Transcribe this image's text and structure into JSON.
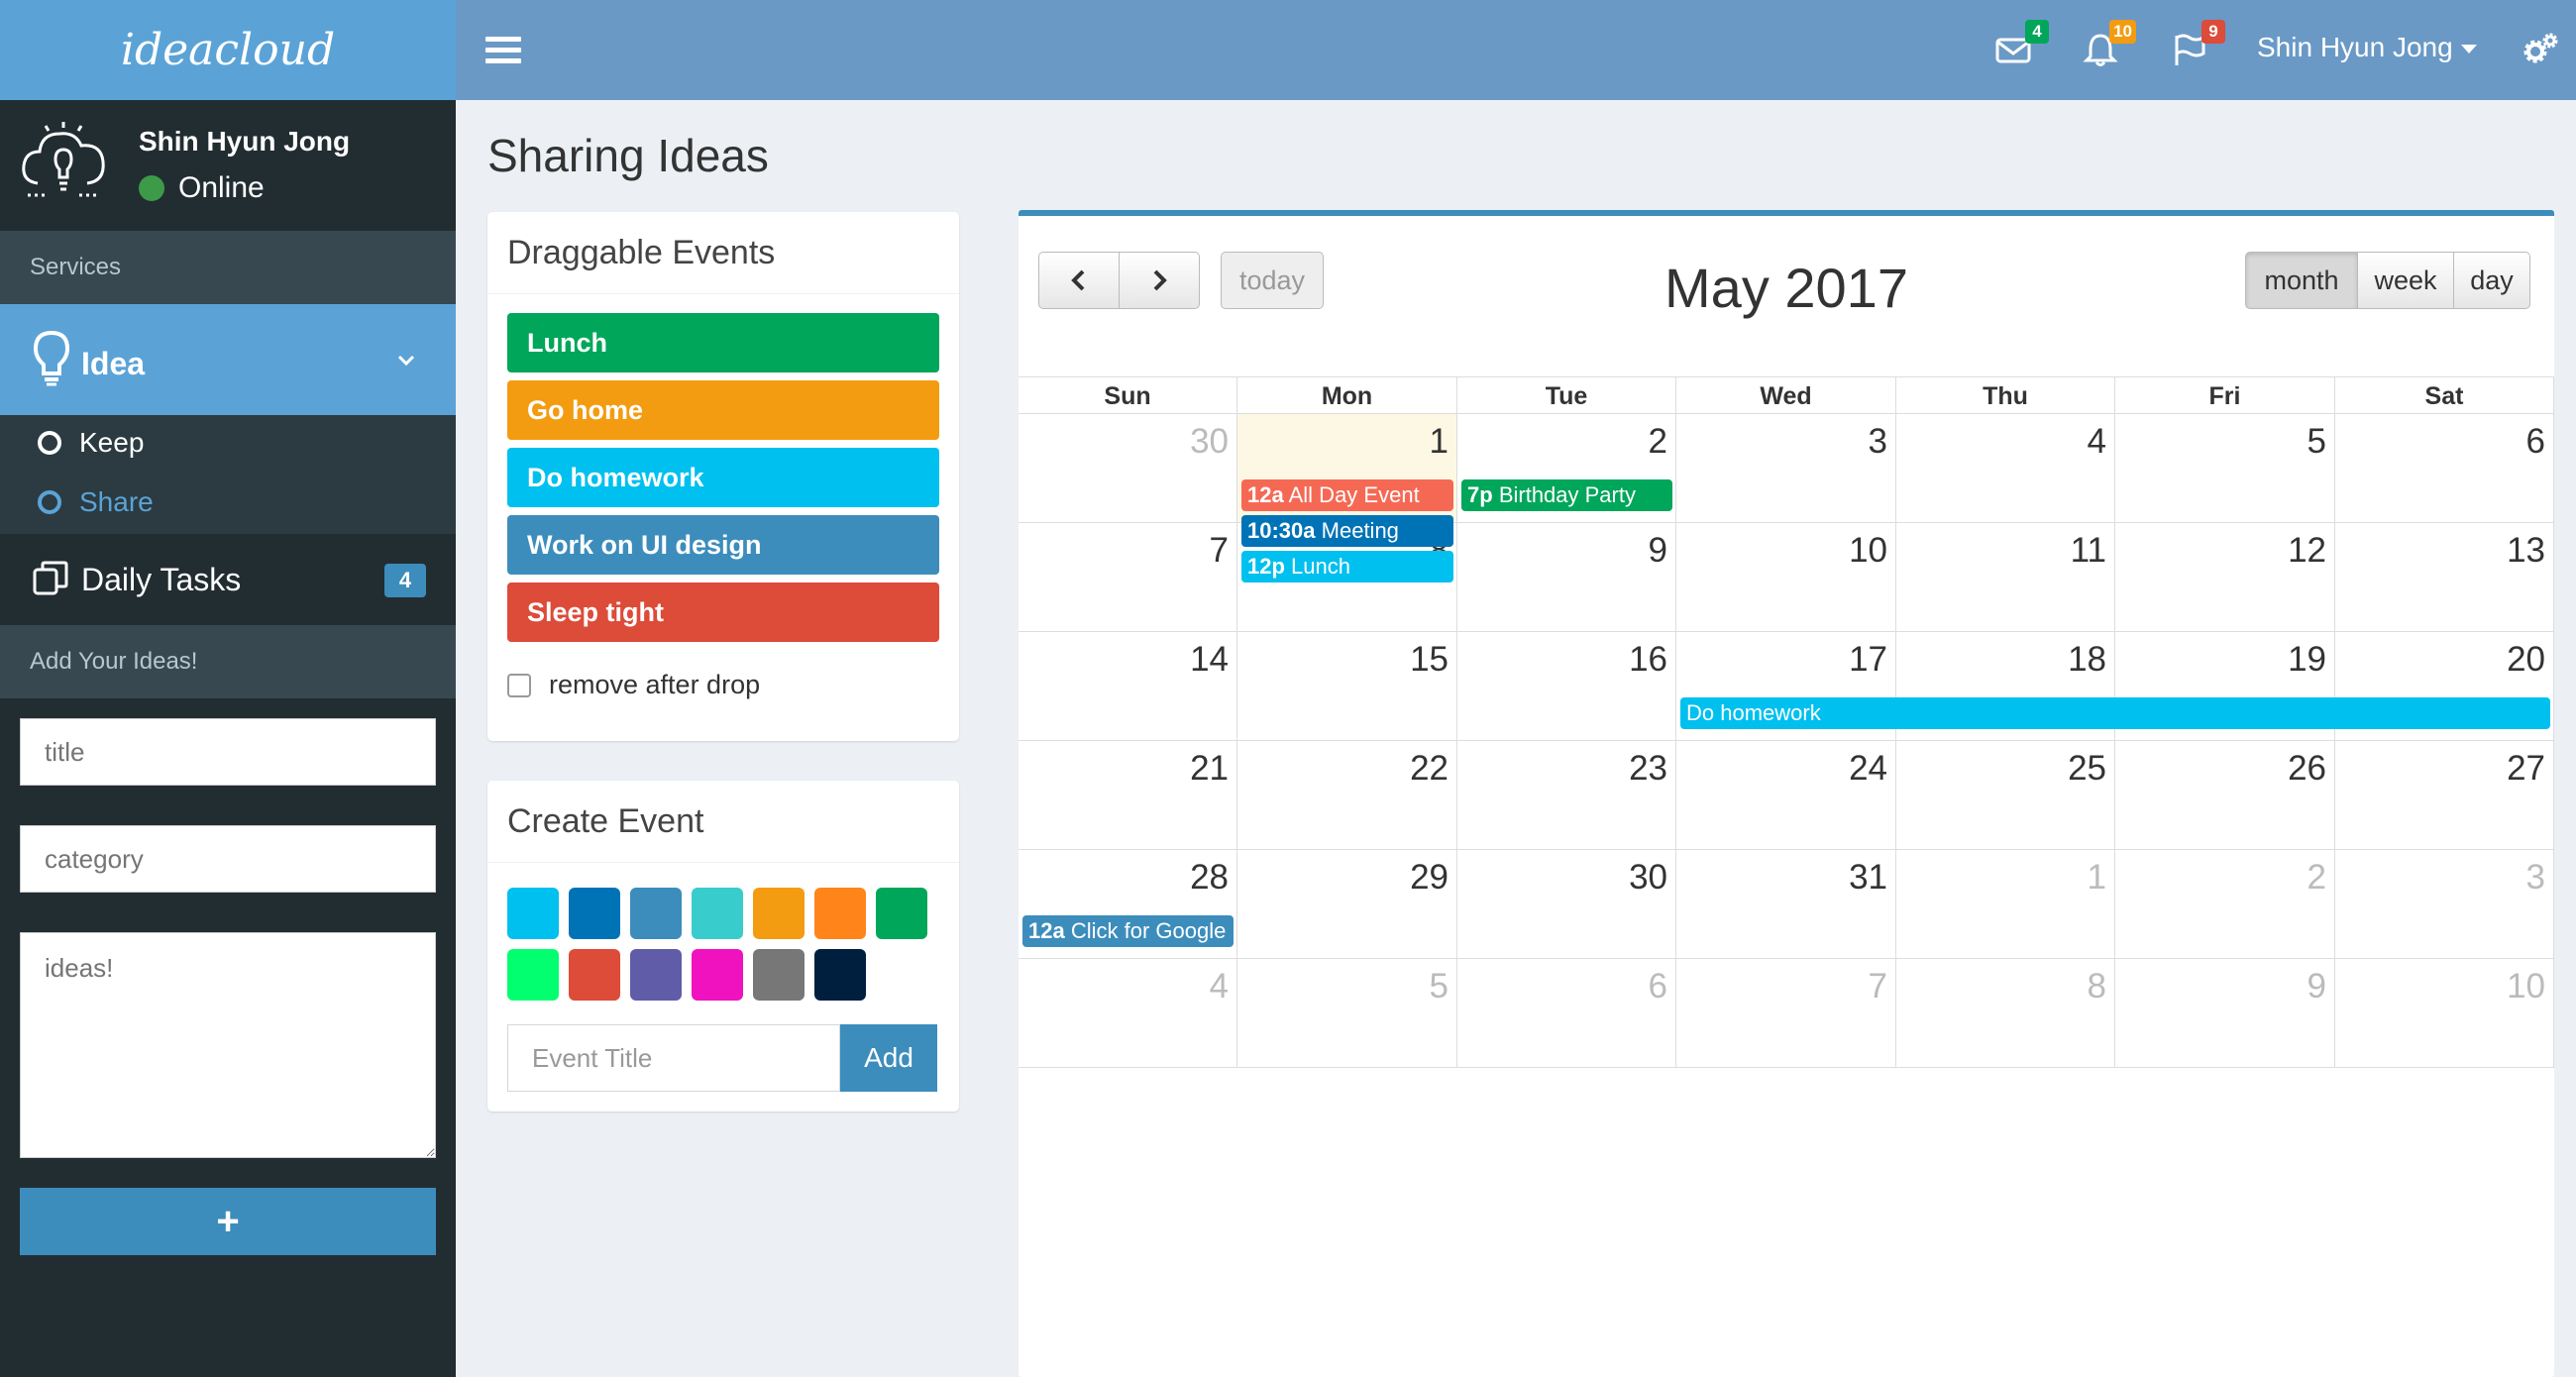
{
  "brand": {
    "logo": "ideacloud"
  },
  "navbar": {
    "mail_count": "4",
    "bell_count": "10",
    "flag_count": "9",
    "user_name": "Shin Hyun Jong",
    "colors": {
      "mail": "#00a65a",
      "bell": "#f39c12",
      "flag": "#dd4b39"
    }
  },
  "sidebar": {
    "user": {
      "name": "Shin Hyun Jong",
      "status": "Online"
    },
    "services_header": "Services",
    "idea": {
      "label": "Idea",
      "items": [
        {
          "label": "Keep"
        },
        {
          "label": "Share"
        }
      ]
    },
    "daily_tasks": {
      "label": "Daily Tasks",
      "count": "4"
    },
    "add_header": "Add Your Ideas!",
    "form": {
      "title_placeholder": "title",
      "category_placeholder": "category",
      "ideas_placeholder": "ideas!",
      "add_label": "+"
    }
  },
  "page": {
    "title": "Sharing Ideas"
  },
  "draggable": {
    "title": "Draggable Events",
    "events": [
      {
        "label": "Lunch",
        "color": "#00a65a"
      },
      {
        "label": "Go home",
        "color": "#f39c12"
      },
      {
        "label": "Do homework",
        "color": "#00c0ef"
      },
      {
        "label": "Work on UI design",
        "color": "#3c8dbc"
      },
      {
        "label": "Sleep tight",
        "color": "#dd4b39"
      }
    ],
    "remove_label": "remove after drop"
  },
  "create_event": {
    "title": "Create Event",
    "colors": [
      "#00c0ef",
      "#0073b7",
      "#3c8dbc",
      "#39cccc",
      "#f39c12",
      "#ff851b",
      "#00a65a",
      "#01ff70",
      "#dd4b39",
      "#605ca8",
      "#f012be",
      "#777777",
      "#001f3f"
    ],
    "input_placeholder": "Event Title",
    "add_label": "Add"
  },
  "calendar": {
    "title": "May 2017",
    "today_label": "today",
    "views": [
      "month",
      "week",
      "day"
    ],
    "active_view": "month",
    "weekdays": [
      "Sun",
      "Mon",
      "Tue",
      "Wed",
      "Thu",
      "Fri",
      "Sat"
    ],
    "weeks": [
      [
        "30",
        "1",
        "2",
        "3",
        "4",
        "5",
        "6"
      ],
      [
        "7",
        "8",
        "9",
        "10",
        "11",
        "12",
        "13"
      ],
      [
        "14",
        "15",
        "16",
        "17",
        "18",
        "19",
        "20"
      ],
      [
        "21",
        "22",
        "23",
        "24",
        "25",
        "26",
        "27"
      ],
      [
        "28",
        "29",
        "30",
        "31",
        "1",
        "2",
        "3"
      ],
      [
        "4",
        "5",
        "6",
        "7",
        "8",
        "9",
        "10"
      ]
    ],
    "events": [
      {
        "time": "12a",
        "title": "All Day Event",
        "color": "#f56954"
      },
      {
        "time": "10:30a",
        "title": "Meeting",
        "color": "#0073b7"
      },
      {
        "time": "12p",
        "title": "Lunch",
        "color": "#00c0ef"
      },
      {
        "time": "7p",
        "title": "Birthday Party",
        "color": "#00a65a"
      },
      {
        "time": "",
        "title": "Do homework",
        "color": "#00c0ef"
      },
      {
        "time": "12a",
        "title": "Click for Google",
        "color": "#3c8dbc"
      }
    ]
  }
}
